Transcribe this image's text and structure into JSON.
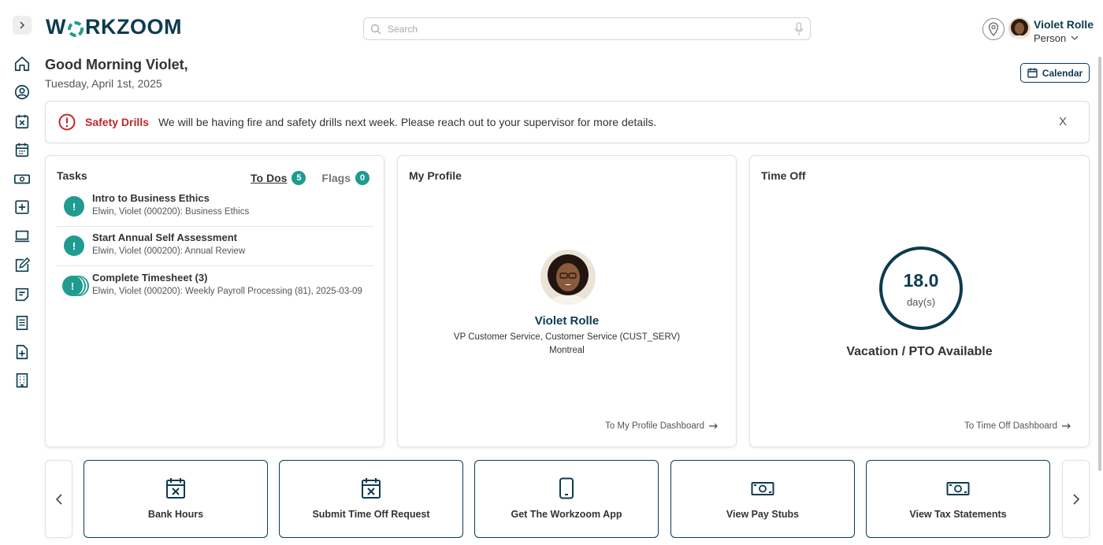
{
  "brand": {
    "logo_text_pre": "W",
    "logo_text_post": "RKZOOM",
    "accent": "#1f9b8f",
    "primary": "#0d3b4f",
    "alert_red": "#c0262d"
  },
  "search": {
    "placeholder": "Search"
  },
  "user": {
    "name": "Violet Rolle",
    "role": "Person"
  },
  "greeting": {
    "title": "Good Morning Violet,",
    "date": "Tuesday, April 1st, 2025"
  },
  "calendar_button": {
    "label": "Calendar"
  },
  "alert": {
    "title": "Safety Drills",
    "message": "We will be having fire and safety drills next week. Please reach out to your supervisor for more details.",
    "close": "X"
  },
  "sidebar": {
    "items": [
      "home-icon",
      "profile-icon",
      "time-off-icon",
      "schedule-icon",
      "pay-icon",
      "add-icon",
      "laptop-icon",
      "edit-icon",
      "notes-icon",
      "document-icon",
      "new-document-icon",
      "building-icon"
    ]
  },
  "tasks": {
    "title": "Tasks",
    "tabs": [
      {
        "label": "To Dos",
        "count": "5"
      },
      {
        "label": "Flags",
        "count": "0"
      }
    ],
    "items": [
      {
        "icon": "!",
        "title": "Intro to Business Ethics",
        "subtitle": "Elwin, Violet (000200): Business Ethics"
      },
      {
        "icon": "!",
        "title": "Start Annual Self Assessment",
        "subtitle": "Elwin, Violet (000200): Annual Review"
      },
      {
        "icon": "!",
        "title": "Complete Timesheet (3)",
        "subtitle": "Elwin, Violet (000200): Weekly Payroll Processing (81), 2025-03-09"
      }
    ]
  },
  "profile": {
    "title": "My Profile",
    "name": "Violet Rolle",
    "job": "VP Customer Service, Customer Service (CUST_SERV)",
    "location": "Montreal",
    "link": "To My Profile Dashboard"
  },
  "time_off": {
    "title": "Time Off",
    "value": "18.0",
    "unit": "day(s)",
    "label": "Vacation / PTO Available",
    "link": "To Time Off Dashboard"
  },
  "quick_actions": [
    {
      "label": "Bank Hours",
      "icon": "calendar-x-icon"
    },
    {
      "label": "Submit Time Off Request",
      "icon": "calendar-x-icon"
    },
    {
      "label": "Get The Workzoom App",
      "icon": "phone-icon"
    },
    {
      "label": "View Pay Stubs",
      "icon": "money-icon"
    },
    {
      "label": "View Tax Statements",
      "icon": "money-icon"
    }
  ]
}
